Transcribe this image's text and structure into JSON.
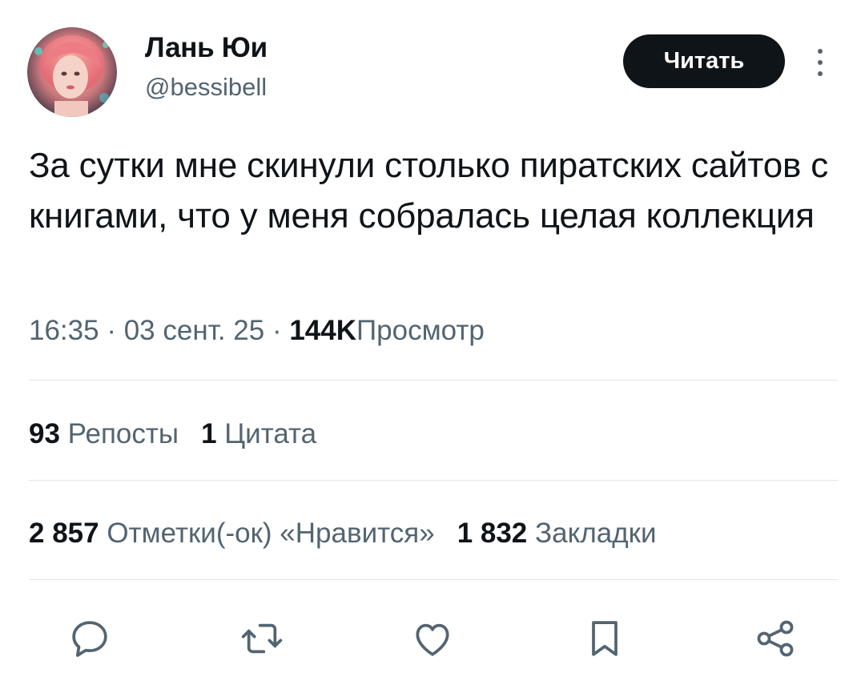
{
  "author": {
    "name": "Лань Юи",
    "handle": "@bessibell",
    "avatar_icon": "avatar-pink-hair-portrait"
  },
  "follow_button": {
    "label": "Читать"
  },
  "more_icon": "vertical-dots-icon",
  "tweet": {
    "text": "За сутки мне скинули столько пиратских сайтов с книгами, что у меня собралась целая коллекция"
  },
  "meta": {
    "time": "16:35",
    "separator": "·",
    "date": "03 сент. 25",
    "views_count": "144K",
    "views_label": "Просмотр"
  },
  "stats": {
    "reposts_count": "93",
    "reposts_label": "Репосты",
    "quotes_count": "1",
    "quotes_label": "Цитата",
    "likes_count": "2 857",
    "likes_label": "Отметки(-ок) «Нравится»",
    "bookmarks_count": "1 832",
    "bookmarks_label": "Закладки"
  },
  "actions": [
    {
      "icon": "reply-icon"
    },
    {
      "icon": "repost-icon"
    },
    {
      "icon": "like-icon"
    },
    {
      "icon": "bookmark-icon"
    },
    {
      "icon": "share-icon"
    }
  ],
  "colors": {
    "text_primary": "#0f1419",
    "text_secondary": "#536471",
    "divider": "#e2e6e9",
    "button_bg": "#0f1419",
    "button_text": "#ffffff"
  }
}
